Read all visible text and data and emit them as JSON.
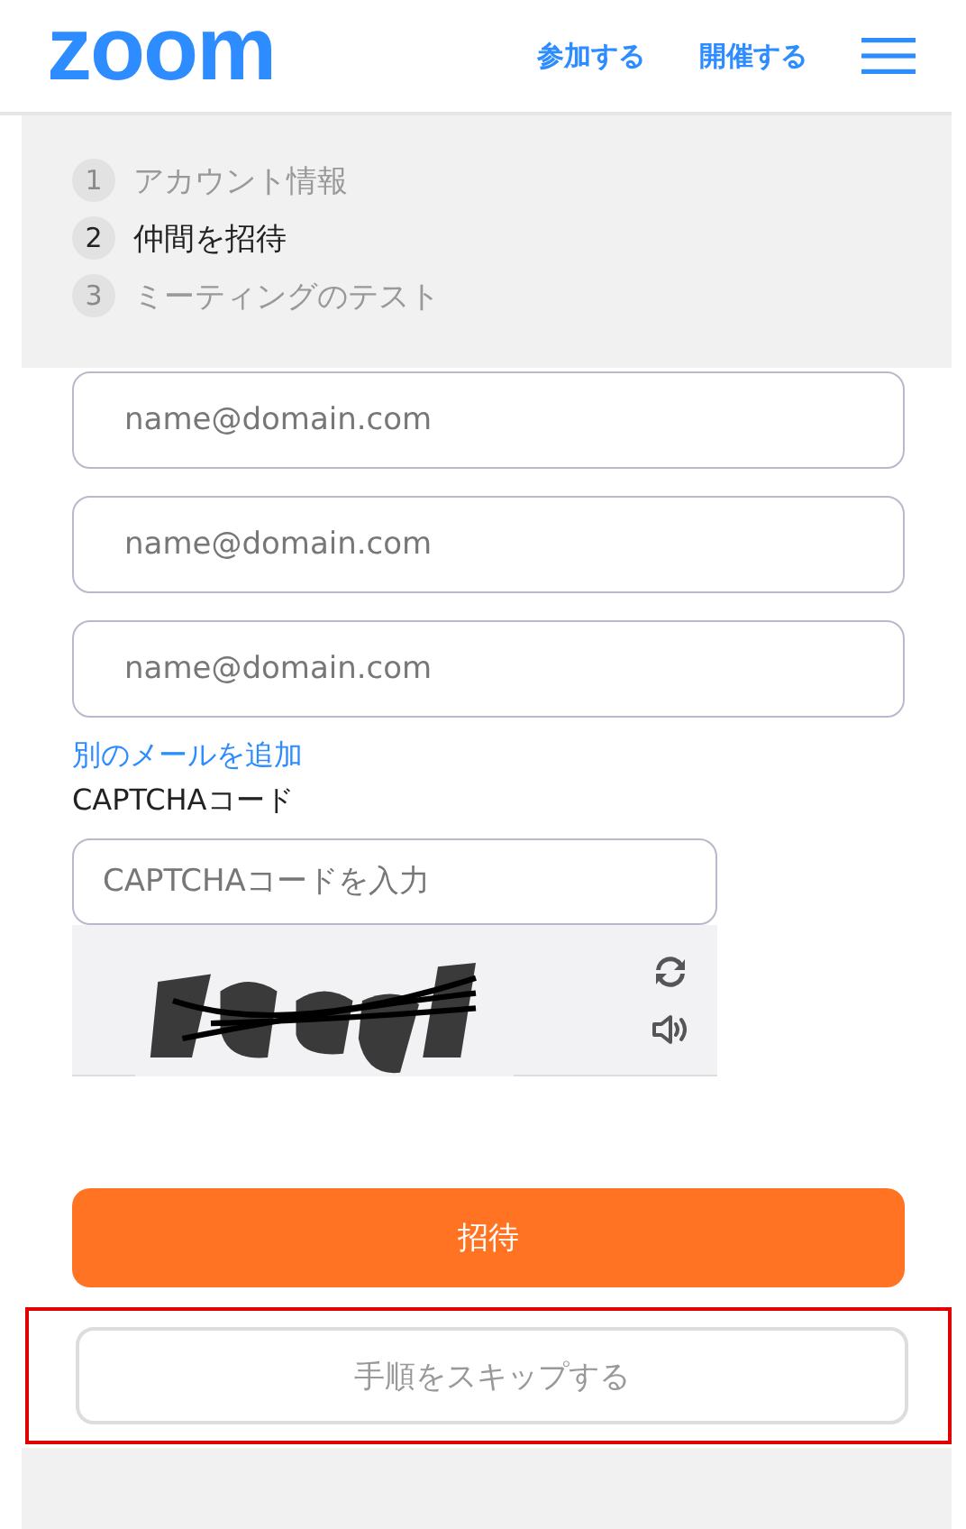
{
  "header": {
    "logo": "zoom",
    "links": [
      "参加する",
      "開催する"
    ]
  },
  "steps": [
    {
      "number": "1",
      "label": "アカウント情報",
      "selected": false
    },
    {
      "number": "2",
      "label": "仲間を招待",
      "selected": true
    },
    {
      "number": "3",
      "label": "ミーティングのテスト",
      "selected": false
    }
  ],
  "email_fields": [
    {
      "placeholder": "name@domain.com"
    },
    {
      "placeholder": "name@domain.com"
    },
    {
      "placeholder": "name@domain.com"
    }
  ],
  "add_email_link": "別のメールを追加",
  "captcha": {
    "label": "CAPTCHAコード",
    "placeholder": "CAPTCHAコードを入力"
  },
  "invite_button": "招待",
  "skip_button": {
    "label": "手順をスキップする",
    "highlighted": true
  }
}
